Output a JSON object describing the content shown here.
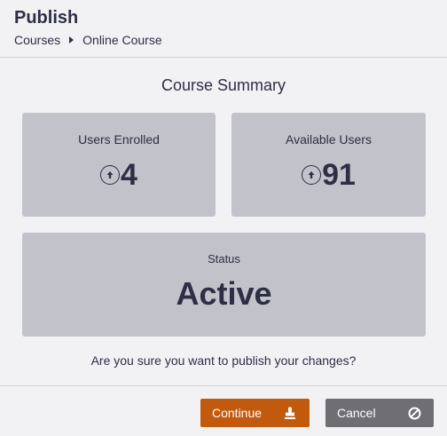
{
  "header": {
    "title": "Publish",
    "breadcrumb": [
      "Courses",
      "Online Course"
    ]
  },
  "summary": {
    "title": "Course Summary",
    "users_enrolled": {
      "label": "Users Enrolled",
      "value": "4",
      "icon": "arrow-up-circle-icon"
    },
    "available_users": {
      "label": "Available Users",
      "value": "91",
      "icon": "arrow-up-circle-icon"
    },
    "status": {
      "label": "Status",
      "value": "Active"
    }
  },
  "confirm_text": "Are you sure you want to publish your changes?",
  "buttons": {
    "continue": {
      "label": "Continue",
      "icon": "stamp-icon",
      "color": "#c25a0e"
    },
    "cancel": {
      "label": "Cancel",
      "icon": "ban-icon",
      "color": "#6e6e73"
    }
  },
  "colors": {
    "card_bg": "#c2c2ca",
    "text": "#2e2e45",
    "page_bg": "#f2f2f4"
  }
}
